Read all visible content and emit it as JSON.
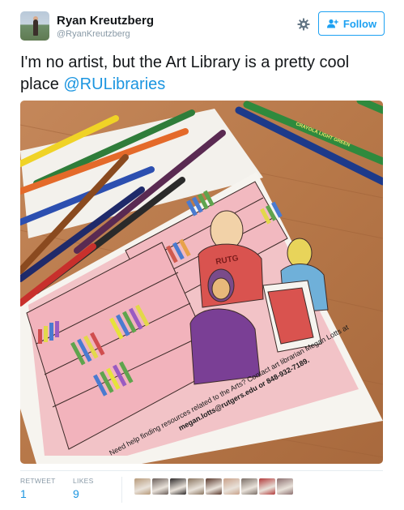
{
  "user": {
    "display_name": "Ryan Kreutzberg",
    "screen_name": "@RyanKreutzberg",
    "avatar": "profile-photo"
  },
  "actions": {
    "gear_icon": "gear-icon",
    "follow_label": "Follow",
    "follow_icon": "add-user-icon"
  },
  "tweet": {
    "text_before": "I'm no artist, but the Art Library is a pretty cool place ",
    "mention": "@RULibraries"
  },
  "media": {
    "description_text": [
      "Need help finding resources related to the Arts? Contact art librarian Megan Lotts at",
      "megan.lotts@rutgers.edu or 848-932-7189.",
      "RUTG"
    ]
  },
  "stats": {
    "retweet_label": "RETWEET",
    "retweet_count": "1",
    "likes_label": "LIKES",
    "likes_count": "9"
  },
  "likers": [
    {
      "color": "#b79a7a"
    },
    {
      "color": "#6b5f5a"
    },
    {
      "color": "#2f2b2b"
    },
    {
      "color": "#8a7560"
    },
    {
      "color": "#5b3a2e"
    },
    {
      "color": "#c9a28a"
    },
    {
      "color": "#7a6e66"
    },
    {
      "color": "#b23b3b"
    },
    {
      "color": "#8c6f6f"
    }
  ],
  "colors": {
    "accent": "#1da1f2",
    "link": "#1b95e0",
    "muted": "#8899a6"
  }
}
